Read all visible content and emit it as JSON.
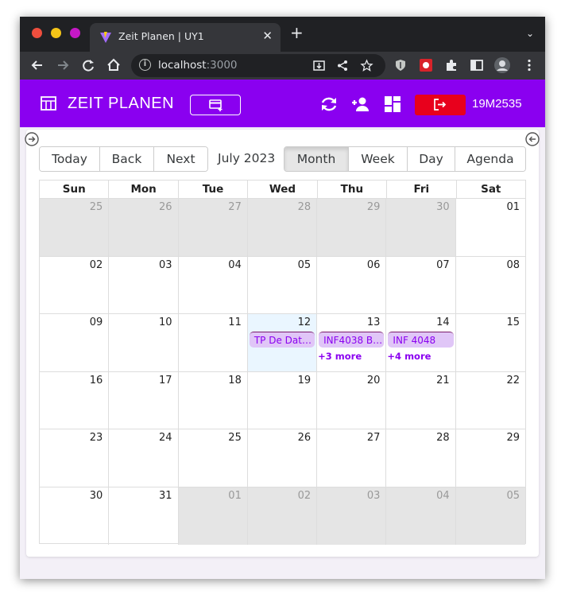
{
  "browser": {
    "tab_title": "Zeit Planen | UY1",
    "tab_close": "✕",
    "new_tab": "+",
    "tab_menu": "⌄",
    "url_host": "localhost",
    "url_port": ":3000",
    "info": "i"
  },
  "header": {
    "title": "ZEIT PLANEN",
    "user_id": "19M2535",
    "brand_color": "#8a00f0",
    "logout_color": "#e8001c"
  },
  "toolbar": {
    "today": "Today",
    "back": "Back",
    "next": "Next",
    "label": "July 2023",
    "views": [
      "Month",
      "Week",
      "Day",
      "Agenda"
    ],
    "active_view": "Month"
  },
  "calendar": {
    "weekdays": [
      "Sun",
      "Mon",
      "Tue",
      "Wed",
      "Thu",
      "Fri",
      "Sat"
    ],
    "weeks": [
      [
        "25",
        "26",
        "27",
        "28",
        "29",
        "30",
        "01"
      ],
      [
        "02",
        "03",
        "04",
        "05",
        "06",
        "07",
        "08"
      ],
      [
        "09",
        "10",
        "11",
        "12",
        "13",
        "14",
        "15"
      ],
      [
        "16",
        "17",
        "18",
        "19",
        "20",
        "21",
        "22"
      ],
      [
        "23",
        "24",
        "25",
        "26",
        "27",
        "28",
        "29"
      ],
      [
        "30",
        "31",
        "01",
        "02",
        "03",
        "04",
        "05"
      ]
    ],
    "today": "12",
    "events": [
      {
        "day": "12",
        "title": "TP De Data..."
      },
      {
        "day": "13",
        "title": "INF4038 Ba..."
      },
      {
        "day": "14",
        "title": "INF 4048"
      }
    ],
    "more": [
      {
        "day": "13",
        "label": "+3 more"
      },
      {
        "day": "14",
        "label": "+4 more"
      }
    ]
  }
}
